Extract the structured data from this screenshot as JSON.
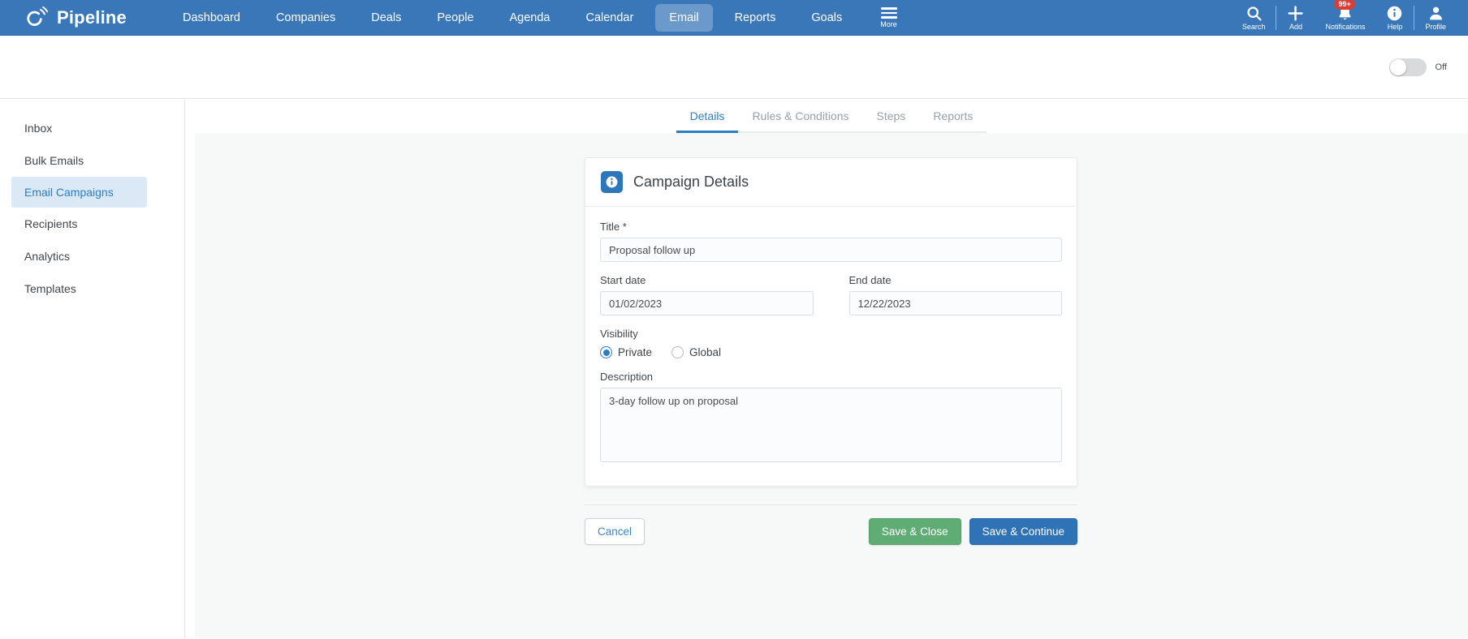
{
  "brand": {
    "name": "Pipeline"
  },
  "nav": {
    "items": [
      {
        "label": "Dashboard",
        "active": false
      },
      {
        "label": "Companies",
        "active": false
      },
      {
        "label": "Deals",
        "active": false
      },
      {
        "label": "People",
        "active": false
      },
      {
        "label": "Agenda",
        "active": false
      },
      {
        "label": "Calendar",
        "active": false
      },
      {
        "label": "Email",
        "active": true
      },
      {
        "label": "Reports",
        "active": false
      },
      {
        "label": "Goals",
        "active": false
      }
    ],
    "more": {
      "label": "More"
    },
    "actions": {
      "search": {
        "label": "Search"
      },
      "add": {
        "label": "Add"
      },
      "notifications": {
        "label": "Notifications",
        "badge": "99+"
      },
      "help": {
        "label": "Help"
      },
      "profile": {
        "label": "Profile"
      }
    }
  },
  "header_bar": {
    "toggle": {
      "label": "Off",
      "state": "off"
    }
  },
  "sidebar": {
    "items": [
      {
        "label": "Inbox",
        "active": false
      },
      {
        "label": "Bulk Emails",
        "active": false
      },
      {
        "label": "Email Campaigns",
        "active": true
      },
      {
        "label": "Recipients",
        "active": false
      },
      {
        "label": "Analytics",
        "active": false
      },
      {
        "label": "Templates",
        "active": false
      }
    ]
  },
  "tabs": [
    {
      "label": "Details",
      "active": true
    },
    {
      "label": "Rules & Conditions",
      "active": false
    },
    {
      "label": "Steps",
      "active": false
    },
    {
      "label": "Reports",
      "active": false
    }
  ],
  "campaign_form": {
    "card_title": "Campaign Details",
    "fields": {
      "title": {
        "label": "Title *",
        "value": "Proposal follow up"
      },
      "start_date": {
        "label": "Start date",
        "value": "01/02/2023"
      },
      "end_date": {
        "label": "End date",
        "value": "12/22/2023"
      },
      "visibility": {
        "label": "Visibility",
        "options": [
          {
            "label": "Private",
            "selected": true
          },
          {
            "label": "Global",
            "selected": false
          }
        ]
      },
      "description": {
        "label": "Description",
        "value": "3-day follow up on proposal"
      }
    },
    "buttons": {
      "cancel": "Cancel",
      "save_close": "Save & Close",
      "save_continue": "Save & Continue"
    }
  },
  "colors": {
    "nav_blue": "#3a77b8",
    "active_nav_pill": "rgba(255,255,255,0.25)",
    "link_blue": "#2d7dc1",
    "sidebar_active_bg": "#dbe9f6",
    "badge_red": "#d43f3a",
    "green_button": "#5fad74",
    "blue_button": "#2f72b6",
    "content_bg": "#f7f8f8"
  }
}
